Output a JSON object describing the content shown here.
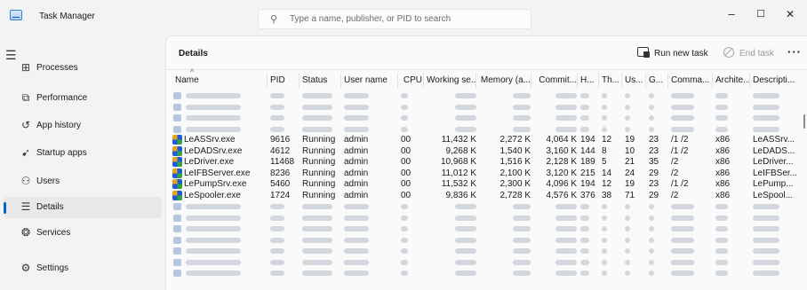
{
  "titlebar": {
    "title": "Task Manager",
    "search_placeholder": "Type a name, publisher, or PID to search",
    "minimize": "–",
    "maximize": "☐",
    "close": "✕"
  },
  "nav": [
    {
      "label": "Processes",
      "icon": "processes-icon",
      "glyph": "⊞"
    },
    {
      "label": "Performance",
      "icon": "performance-icon",
      "glyph": "⧉"
    },
    {
      "label": "App history",
      "icon": "app-history-icon",
      "glyph": "↺"
    },
    {
      "label": "Startup apps",
      "icon": "startup-apps-icon",
      "glyph": "➹"
    },
    {
      "label": "Users",
      "icon": "users-icon",
      "glyph": "⚇"
    },
    {
      "label": "Details",
      "icon": "details-icon",
      "glyph": "☰",
      "active": true
    },
    {
      "label": "Services",
      "icon": "services-icon",
      "glyph": "❂"
    },
    {
      "label": "Settings",
      "icon": "settings-icon",
      "glyph": "⚙"
    }
  ],
  "main": {
    "title": "Details",
    "run_new_task": "Run new task",
    "end_task": "End task",
    "more": "···"
  },
  "columns": [
    "Name",
    "PID",
    "Status",
    "User name",
    "CPU",
    "Working se...",
    "Memory (a...",
    "Commit...",
    "H...",
    "Th...",
    "Us...",
    "G...",
    "Comma...",
    "Archite...",
    "Descripti..."
  ],
  "rows": [
    {
      "blurred": true
    },
    {
      "blurred": true
    },
    {
      "blurred": true
    },
    {
      "blurred": true
    },
    {
      "name": "LeASSrv.exe",
      "pid": "9616",
      "status": "Running",
      "user": "admin",
      "cpu": "00",
      "ws": "11,432 K",
      "mem": "2,272 K",
      "commit": "4,064 K",
      "h": "194",
      "th": "12",
      "us": "19",
      "g": "23",
      "cmd": "/1 /2",
      "arch": "x86",
      "desc": "LeASSrv..."
    },
    {
      "name": "LeDADSrv.exe",
      "pid": "4612",
      "status": "Running",
      "user": "admin",
      "cpu": "00",
      "ws": "9,268 K",
      "mem": "1,540 K",
      "commit": "3,160 K",
      "h": "144",
      "th": "8",
      "us": "10",
      "g": "23",
      "cmd": "/1 /2",
      "arch": "x86",
      "desc": "LeDADS..."
    },
    {
      "name": "LeDriver.exe",
      "pid": "11468",
      "status": "Running",
      "user": "admin",
      "cpu": "00",
      "ws": "10,968 K",
      "mem": "1,516 K",
      "commit": "2,128 K",
      "h": "189",
      "th": "5",
      "us": "21",
      "g": "35",
      "cmd": "/2",
      "arch": "x86",
      "desc": "LeDriver..."
    },
    {
      "name": "LeIFBServer.exe",
      "pid": "8236",
      "status": "Running",
      "user": "admin",
      "cpu": "00",
      "ws": "11,012 K",
      "mem": "2,100 K",
      "commit": "3,120 K",
      "h": "215",
      "th": "14",
      "us": "24",
      "g": "29",
      "cmd": "/2",
      "arch": "x86",
      "desc": "LeIFBSer..."
    },
    {
      "name": "LePumpSrv.exe",
      "pid": "5460",
      "status": "Running",
      "user": "admin",
      "cpu": "00",
      "ws": "11,532 K",
      "mem": "2,300 K",
      "commit": "4,096 K",
      "h": "194",
      "th": "12",
      "us": "19",
      "g": "23",
      "cmd": "/1 /2",
      "arch": "x86",
      "desc": "LePump..."
    },
    {
      "name": "LeSpooler.exe",
      "pid": "1724",
      "status": "Running",
      "user": "admin",
      "cpu": "00",
      "ws": "9,836 K",
      "mem": "2,728 K",
      "commit": "4,576 K",
      "h": "376",
      "th": "38",
      "us": "71",
      "g": "29",
      "cmd": "/2",
      "arch": "x86",
      "desc": "LeSpool..."
    },
    {
      "blurred": true
    },
    {
      "blurred": true
    },
    {
      "blurred": true
    },
    {
      "blurred": true
    },
    {
      "blurred": true
    },
    {
      "blurred": true
    },
    {
      "blurred": true
    }
  ]
}
